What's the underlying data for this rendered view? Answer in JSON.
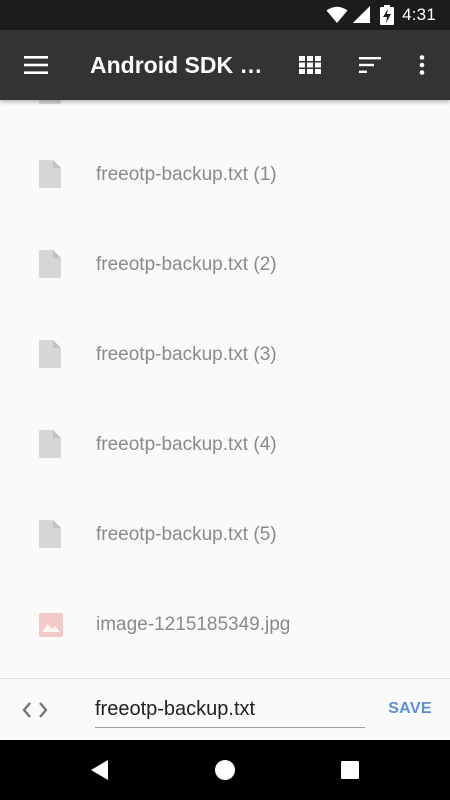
{
  "status_bar": {
    "time": "4:31",
    "icons": [
      "wifi-icon",
      "cell-signal-icon",
      "battery-charging-icon"
    ]
  },
  "toolbar": {
    "title": "Android SDK b…",
    "icons": [
      "menu-icon",
      "grid-view-icon",
      "sort-icon",
      "more-vert-icon"
    ]
  },
  "files": [
    {
      "name": "freeotp-backup.txt (1)",
      "icon": "document-icon"
    },
    {
      "name": "freeotp-backup.txt (2)",
      "icon": "document-icon"
    },
    {
      "name": "freeotp-backup.txt (3)",
      "icon": "document-icon"
    },
    {
      "name": "freeotp-backup.txt (4)",
      "icon": "document-icon"
    },
    {
      "name": "freeotp-backup.txt (5)",
      "icon": "document-icon"
    },
    {
      "name": "image-1215185349.jpg",
      "icon": "image-icon"
    }
  ],
  "save_bar": {
    "filename_value": "freeotp-backup.txt",
    "save_label": "SAVE",
    "icon": "code-icon"
  },
  "colors": {
    "toolbar": "#333333",
    "status_bar": "#1c1c1c",
    "accent": "#5c8fd6",
    "file_icon": "#d6d6d6",
    "image_icon": "#f2c8c8"
  }
}
